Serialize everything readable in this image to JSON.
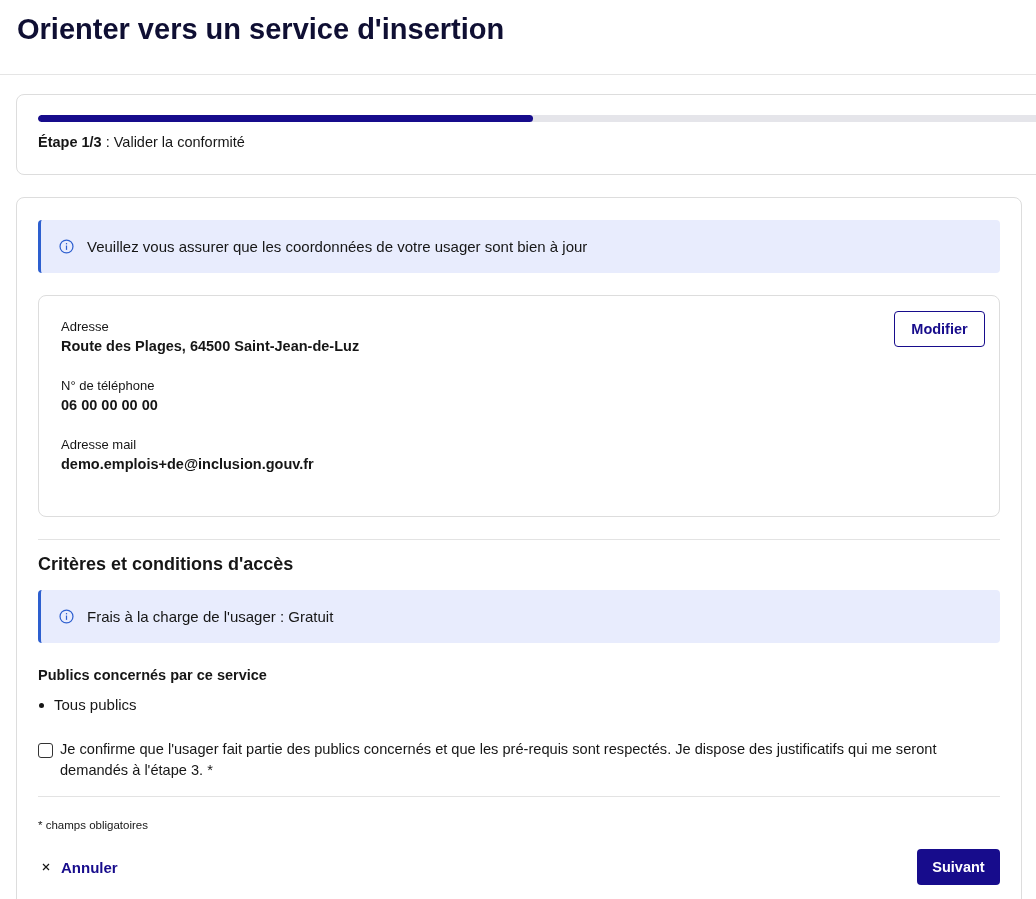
{
  "page": {
    "title": "Orienter vers un service d'insertion"
  },
  "stepper": {
    "text": "**Étape 1/3** : Valider la conformité",
    "level": 0.487
  },
  "contact_notice": {
    "text": "Veuillez vous assurer que les coordonnées de votre usager sont bien à jour"
  },
  "contact_card": {
    "fields": [
      {
        "label": "Adresse",
        "value": "Route des Plages, 64500 Saint-Jean-de-Luz"
      },
      {
        "label": "N° de téléphone",
        "value": "06 00 00 00 00"
      },
      {
        "label": "Adresse mail",
        "value": "demo.emplois+de@inclusion.gouv.fr"
      }
    ],
    "edit_button": "Modifier"
  },
  "criteria": {
    "title": "Critères et conditions d'accès",
    "notice": "Frais à la charge de l'usager : Gratuit",
    "audience_title": "Publics concernés par ce service",
    "audience": [
      "Tous publics"
    ]
  },
  "confirmation": {
    "label": "Je confirme que l'usager fait partie des publics concernés et que les pré-requis sont respectés. Je dispose des justificatifs qui me seront demandés à l'étape 3. *",
    "checked": false
  },
  "required_note": "* champs obligatoires",
  "footer": {
    "cancel": "Annuler",
    "next": "Suivant"
  }
}
